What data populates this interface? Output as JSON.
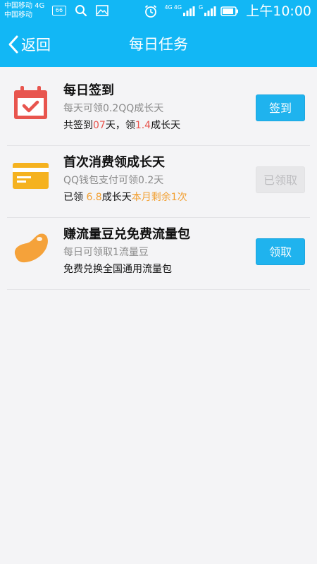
{
  "status_bar": {
    "carrier_1": "中国移动 4G",
    "carrier_2": "中国移动",
    "badge": "66",
    "net_1": "4G",
    "net_2": "4G",
    "net_3": "G",
    "time": "上午10:00"
  },
  "nav": {
    "back_label": "返回",
    "title": "每日任务"
  },
  "tasks": [
    {
      "title": "每日签到",
      "subtitle": "每天可领0.2QQ成长天",
      "info_prefix": "共签到",
      "info_days": "07",
      "info_mid": "天，领",
      "info_amount": "1.4",
      "info_suffix": "成长天",
      "button": "签到"
    },
    {
      "title": "首次消费领成长天",
      "subtitle": "QQ钱包支付可领0.2天",
      "info_prefix": "已领 ",
      "info_amount": "6.8",
      "info_mid": "成长天",
      "info_remaining": "本月剩余1次",
      "button": "已领取"
    },
    {
      "title": "赚流量豆兑免费流量包",
      "subtitle": "每日可领取1流量豆",
      "info": "免费兑换全国通用流量包",
      "button": "领取"
    }
  ],
  "colors": {
    "header": "#12b7f5",
    "button_blue": "#1fb3ee",
    "highlight_red": "#e8554e",
    "highlight_orange": "#f2a033",
    "calendar_icon": "#e8554e",
    "card_icon": "#f5b21f",
    "bean_icon": "#f5a23a"
  }
}
